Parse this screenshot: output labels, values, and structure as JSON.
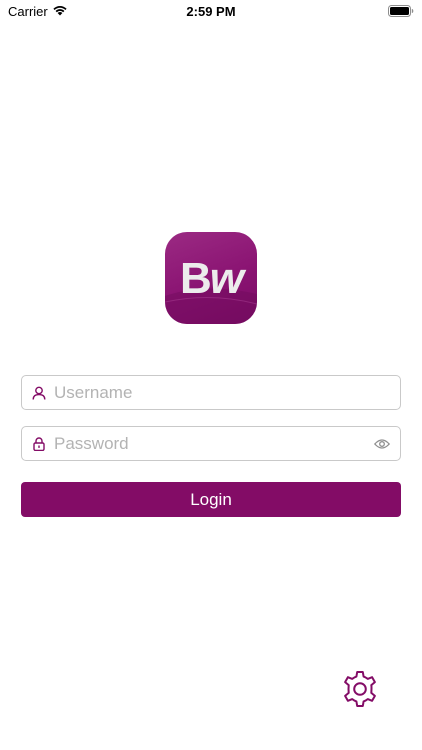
{
  "status_bar": {
    "carrier": "Carrier",
    "time": "2:59 PM",
    "wifi_icon": "wifi-icon",
    "battery_icon": "battery-icon"
  },
  "logo": {
    "text_b": "B",
    "text_w": "w",
    "colors": {
      "background": "#8a1372"
    }
  },
  "login_form": {
    "username": {
      "placeholder": "Username",
      "value": "",
      "icon": "user-icon"
    },
    "password": {
      "placeholder": "Password",
      "value": "",
      "icon": "lock-icon",
      "toggle_icon": "eye-icon"
    },
    "login_label": "Login"
  },
  "settings": {
    "icon": "gear-icon"
  },
  "colors": {
    "accent": "#830c66",
    "field_border": "#c9c9c9",
    "placeholder": "#b3b3b3"
  }
}
